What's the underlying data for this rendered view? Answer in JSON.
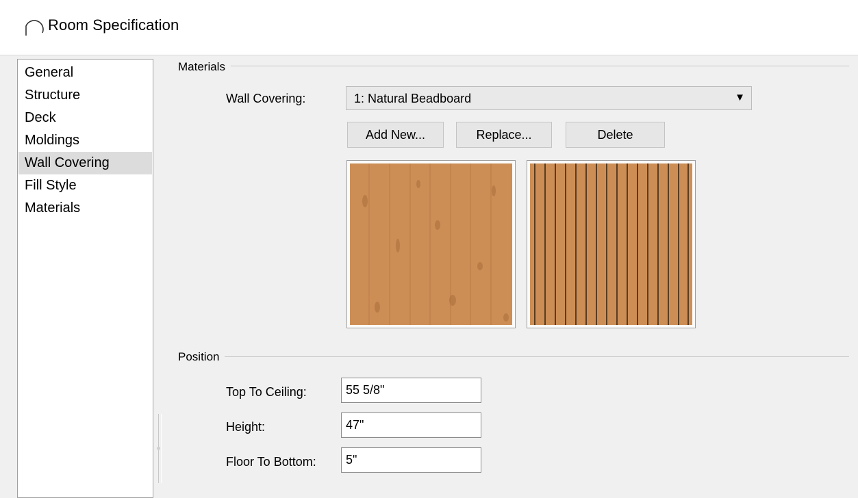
{
  "window": {
    "title": "Room Specification",
    "icon": "arch-icon"
  },
  "sidebar": {
    "items": [
      {
        "label": "General"
      },
      {
        "label": "Structure"
      },
      {
        "label": "Deck"
      },
      {
        "label": "Moldings"
      },
      {
        "label": "Wall Covering",
        "selected": true
      },
      {
        "label": "Fill Style"
      },
      {
        "label": "Materials"
      }
    ]
  },
  "materials": {
    "group_label": "Materials",
    "wall_covering_label": "Wall Covering:",
    "wall_covering_value": "1:  Natural Beadboard",
    "buttons": {
      "add_new": "Add New...",
      "replace": "Replace...",
      "delete": "Delete"
    },
    "texture_color": "#cd8e55"
  },
  "position": {
    "group_label": "Position",
    "top_to_ceiling_label": "Top To Ceiling:",
    "top_to_ceiling_value": "55 5/8\"",
    "height_label": "Height:",
    "height_value": "47\"",
    "floor_to_bottom_label": "Floor To Bottom:",
    "floor_to_bottom_value": "5\""
  }
}
